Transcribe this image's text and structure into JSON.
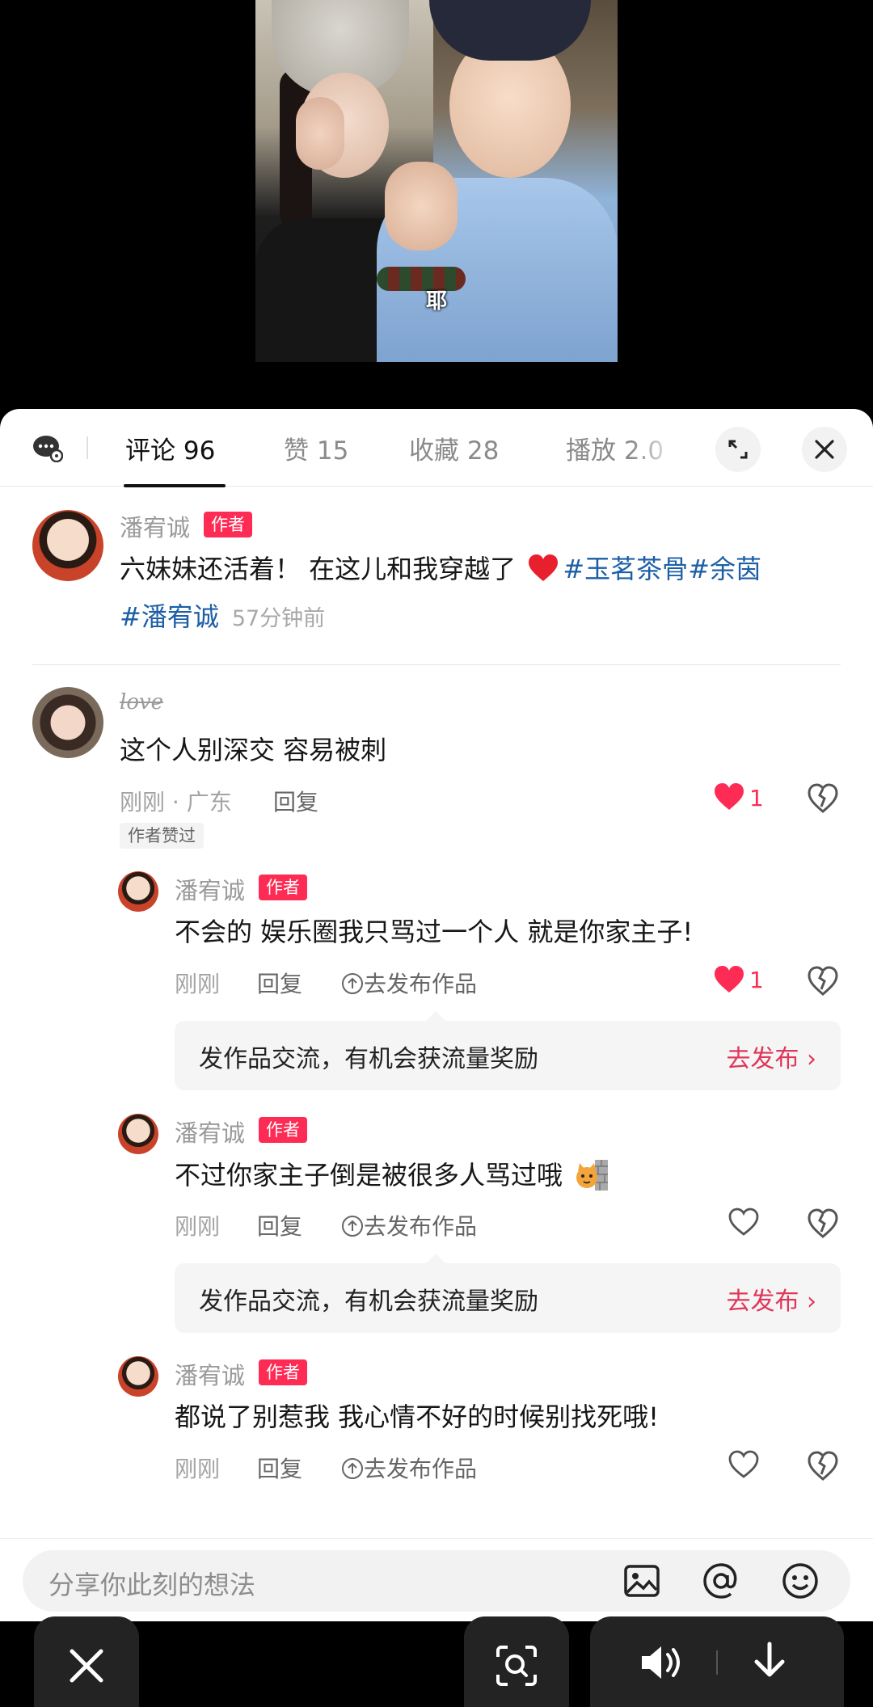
{
  "video": {
    "caption": "耶"
  },
  "tabs": [
    {
      "label": "评论 96"
    },
    {
      "label": "赞 15"
    },
    {
      "label": "收藏 28"
    },
    {
      "label": "播放 2.0"
    }
  ],
  "post": {
    "author": "潘宥诚",
    "badge": "作者",
    "text": "六妹妹还活着！ 在这儿和我穿越了",
    "hashtags": [
      "#玉茗茶骨",
      "#余茵",
      "#潘宥诚"
    ],
    "time": "57分钟前"
  },
  "comment": {
    "user": "love",
    "text": "这个人别深交 容易被刺",
    "meta": "刚刚 · 广东",
    "reply": "回复",
    "likes": "1",
    "author_liked": "作者赞过"
  },
  "replies": [
    {
      "user": "潘宥诚",
      "badge": "作者",
      "text": "不会的 娱乐圈我只骂过一个人 就是你家主子!",
      "time": "刚刚",
      "reply": "回复",
      "publish": "去发布作品",
      "likes": "1",
      "liked": true
    },
    {
      "user": "潘宥诚",
      "badge": "作者",
      "text": "不过你家主子倒是被很多人骂过哦",
      "time": "刚刚",
      "reply": "回复",
      "publish": "去发布作品",
      "likes": "",
      "liked": false
    },
    {
      "user": "潘宥诚",
      "badge": "作者",
      "text": "都说了别惹我 我心情不好的时候别找死哦!",
      "time": "刚刚",
      "reply": "回复",
      "publish": "去发布作品",
      "likes": "",
      "liked": false
    }
  ],
  "promo": {
    "text": "发作品交流，有机会获流量奖励",
    "link": "去发布 ›"
  },
  "input": {
    "placeholder": "分享你此刻的想法"
  },
  "colors": {
    "accent": "#fe2c55",
    "hashtag": "#1d5fa6"
  }
}
